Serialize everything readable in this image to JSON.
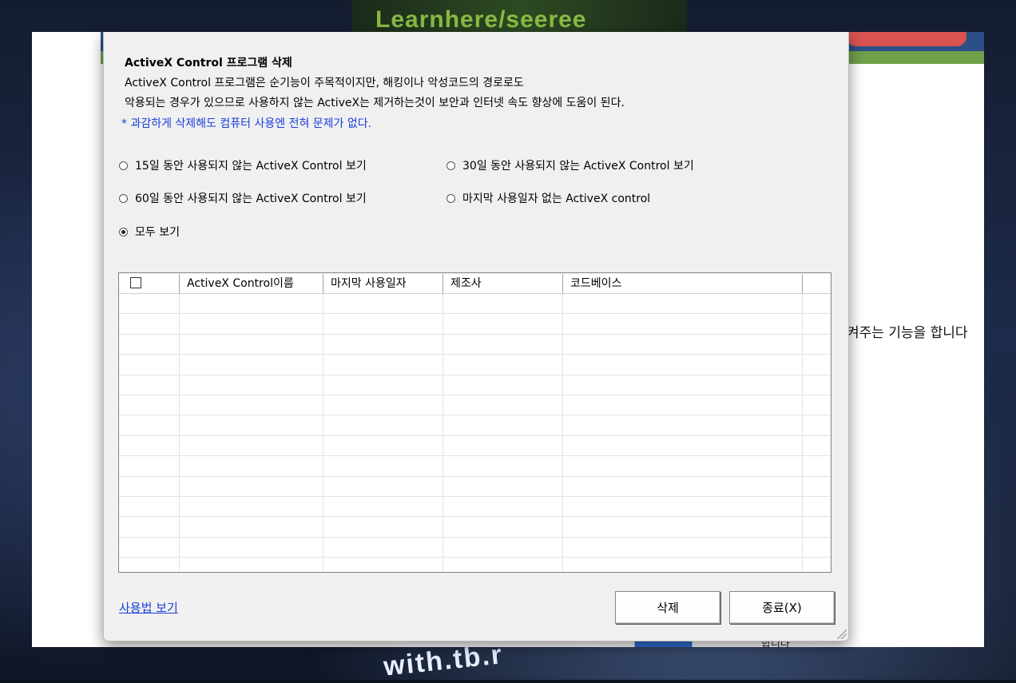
{
  "background": {
    "banner_text": "Learnhere/seeree",
    "bottom_text": "with.tb.r"
  },
  "webpage": {
    "side_text": "켜주는 기능을 합니다",
    "bottom_right_text": "합니다"
  },
  "dialog": {
    "title": "ActiveX Control 프로그램 삭제",
    "desc_line1": "ActiveX Control 프로그램은 순기능이 주목적이지만, 해킹이나 악성코드의 경로로도",
    "desc_line2": "악용되는 경우가 있으므로 사용하지 않는 ActiveX는 제거하는것이 보안과 인터넷 속도 향상에 도움이 된다.",
    "note": "* 과감하게 삭제해도 컴퓨터 사용엔 전혀 문제가 없다.",
    "filters": [
      {
        "label": "15일 동안 사용되지 않는 ActiveX Control 보기",
        "checked": false
      },
      {
        "label": "30일 동안 사용되지 않는 ActiveX Control 보기",
        "checked": false
      },
      {
        "label": "60일 동안 사용되지 않는 ActiveX Control 보기",
        "checked": false
      },
      {
        "label": "마지막 사용일자 없는 ActiveX control",
        "checked": false
      },
      {
        "label": "모두 보기",
        "checked": true
      }
    ],
    "table": {
      "columns": [
        "ActiveX Control이름",
        "마지막 사용일자",
        "제조사",
        "코드베이스"
      ],
      "rows": []
    },
    "help_link": "사용법 보기",
    "delete_button": "삭제",
    "close_button": "종료(X)"
  }
}
